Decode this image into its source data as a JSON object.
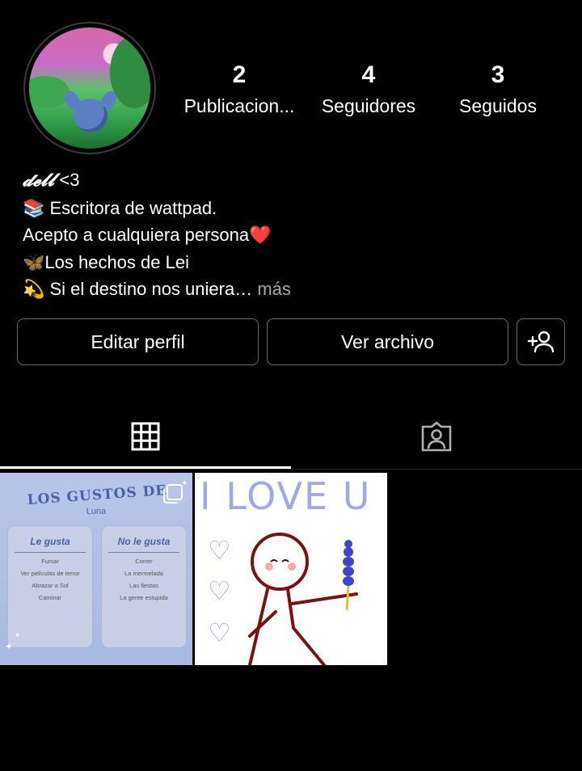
{
  "profile": {
    "stats": [
      {
        "count": "2",
        "label": "Publicacion..."
      },
      {
        "count": "4",
        "label": "Seguidores"
      },
      {
        "count": "3",
        "label": "Seguidos"
      }
    ],
    "bio": {
      "name": "𝓭𝓮𝓵𝓵",
      "name_suffix": " <3",
      "line1": "📚 Escritora de wattpad.",
      "line2": "Acepto a cualquiera persona❤️",
      "line3": "🦋Los hechos de Lei",
      "line4": "💫 Si el destino nos uniera…",
      "more": " más"
    }
  },
  "actions": {
    "edit_profile": "Editar perfil",
    "view_archive": "Ver archivo"
  },
  "tabs": [
    "grid-tab",
    "tagged-tab"
  ],
  "posts": {
    "post1": {
      "title": "LOS GUSTOS DE",
      "subtitle": "Luna",
      "likes_header": "Le gusta",
      "likes": [
        "Fumar",
        "Ver películas de terror",
        "Abrazar a Sol",
        "Caminar"
      ],
      "dislikes_header": "No le gusta",
      "dislikes": [
        "Correr",
        "La mermelada",
        "Las fiestas",
        "La gente estupida"
      ]
    },
    "post2": {
      "title": "I LOVE U"
    }
  },
  "colors": {
    "background": "#000000",
    "border": "#6b6b6b",
    "muted_text": "#a8a8a8",
    "post_accent": "#9fa8e8"
  }
}
